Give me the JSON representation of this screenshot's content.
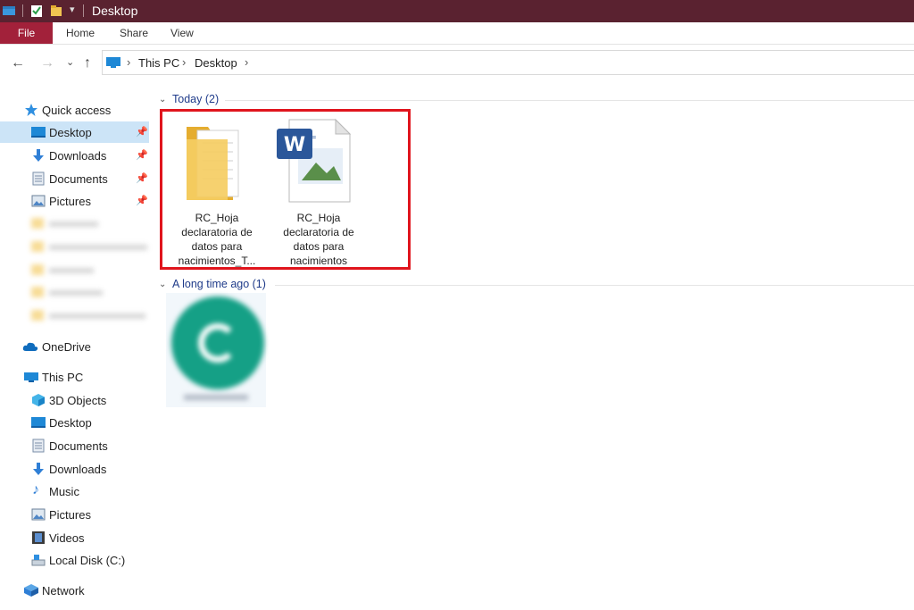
{
  "window": {
    "title": "Desktop"
  },
  "ribbon": {
    "tabs": [
      "File",
      "Home",
      "Share",
      "View"
    ]
  },
  "address": {
    "crumbs": [
      "This PC",
      "Desktop"
    ]
  },
  "sidebar": {
    "quick_access": {
      "label": "Quick access",
      "items": [
        {
          "label": "Desktop"
        },
        {
          "label": "Downloads"
        },
        {
          "label": "Documents"
        },
        {
          "label": "Pictures"
        }
      ],
      "blurred_count": 5
    },
    "onedrive": "OneDrive",
    "this_pc": {
      "label": "This PC",
      "items": [
        {
          "label": "3D Objects"
        },
        {
          "label": "Desktop"
        },
        {
          "label": "Documents"
        },
        {
          "label": "Downloads"
        },
        {
          "label": "Music"
        },
        {
          "label": "Pictures"
        },
        {
          "label": "Videos"
        },
        {
          "label": "Local Disk (C:)"
        }
      ]
    },
    "network": "Network"
  },
  "groups": [
    {
      "header": "Today (2)",
      "files": [
        {
          "name_lines": [
            "RC_Hoja",
            "declaratoria de",
            "datos para",
            "nacimientos_T..."
          ],
          "icon": "folder-icon"
        },
        {
          "name_lines": [
            "RC_Hoja",
            "declaratoria de",
            "datos para",
            "nacimientos"
          ],
          "icon": "word-document-icon"
        }
      ]
    },
    {
      "header": "A long time ago (1)",
      "files": [
        {
          "name_lines": [],
          "icon": "app-shortcut-icon"
        }
      ]
    }
  ],
  "colors": {
    "titlebar": "#5a2230",
    "file_tab": "#a2213a",
    "selection": "#cce4f7",
    "highlight": "#e0151d",
    "group_header": "#1f3b8a"
  }
}
